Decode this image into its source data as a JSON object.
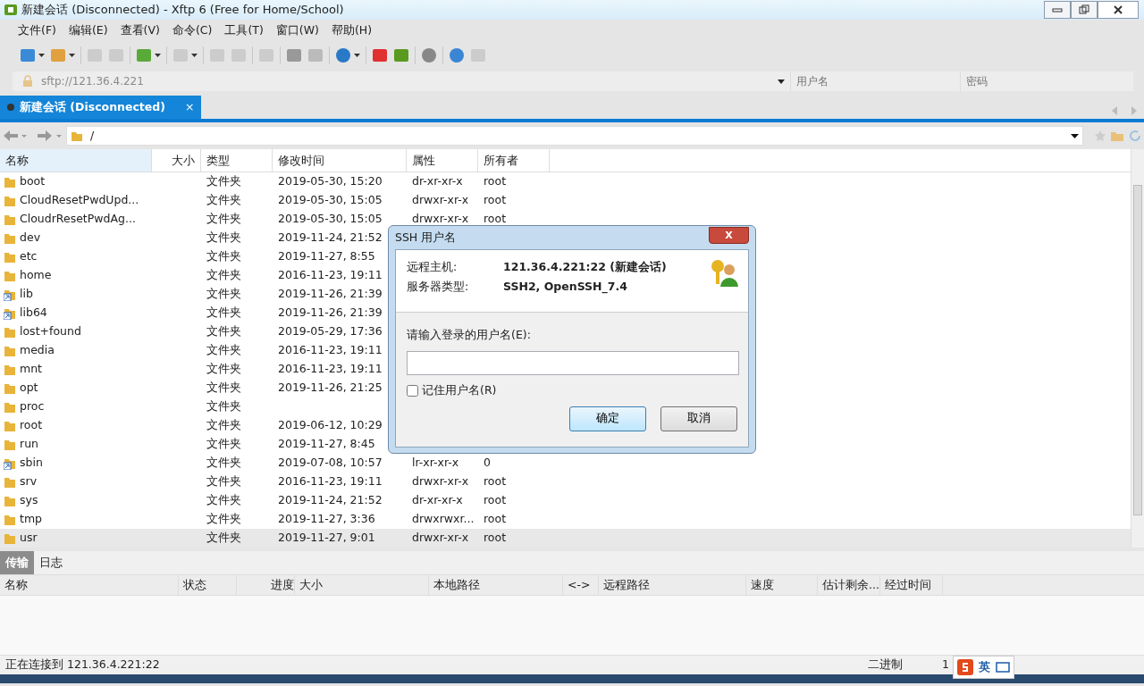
{
  "window": {
    "title": "新建会话 (Disconnected) - Xftp 6 (Free for Home/School)"
  },
  "menu": [
    "文件(F)",
    "编辑(E)",
    "查看(V)",
    "命令(C)",
    "工具(T)",
    "窗口(W)",
    "帮助(H)"
  ],
  "address_bar": {
    "value": "sftp://121.36.4.221",
    "username": {
      "placeholder": "用户名"
    },
    "password": {
      "placeholder": "密码"
    }
  },
  "session_tabs": [
    {
      "label": "新建会话 (Disconnected)",
      "selected": true,
      "close": "×"
    }
  ],
  "path": {
    "value": "/"
  },
  "file_table": {
    "columns": [
      "名称",
      "大小",
      "类型",
      "修改时间",
      "属性",
      "所有者"
    ],
    "rows": [
      {
        "name": "boot",
        "kind": "folder",
        "type": "文件夹",
        "modified": "2019-05-30, 15:20",
        "attributes": "dr-xr-xr-x",
        "owner": "root",
        "selected": false
      },
      {
        "name": "CloudResetPwdUpd...",
        "kind": "folder",
        "type": "文件夹",
        "modified": "2019-05-30, 15:05",
        "attributes": "drwxr-xr-x",
        "owner": "root",
        "selected": false
      },
      {
        "name": "CloudrResetPwdAg...",
        "kind": "folder",
        "type": "文件夹",
        "modified": "2019-05-30, 15:05",
        "attributes": "drwxr-xr-x",
        "owner": "root",
        "selected": false
      },
      {
        "name": "dev",
        "kind": "folder",
        "type": "文件夹",
        "modified": "2019-11-24, 21:52",
        "selected": false
      },
      {
        "name": "etc",
        "kind": "folder",
        "type": "文件夹",
        "modified": "2019-11-27, 8:55",
        "selected": false
      },
      {
        "name": "home",
        "kind": "folder",
        "type": "文件夹",
        "modified": "2016-11-23, 19:11",
        "selected": false
      },
      {
        "name": "lib",
        "kind": "link",
        "type": "文件夹",
        "modified": "2019-11-26, 21:39",
        "selected": false
      },
      {
        "name": "lib64",
        "kind": "link",
        "type": "文件夹",
        "modified": "2019-11-26, 21:39",
        "selected": false
      },
      {
        "name": "lost+found",
        "kind": "folder",
        "type": "文件夹",
        "modified": "2019-05-29, 17:36",
        "selected": false
      },
      {
        "name": "media",
        "kind": "folder",
        "type": "文件夹",
        "modified": "2016-11-23, 19:11",
        "selected": false
      },
      {
        "name": "mnt",
        "kind": "folder",
        "type": "文件夹",
        "modified": "2016-11-23, 19:11",
        "selected": false
      },
      {
        "name": "opt",
        "kind": "folder",
        "type": "文件夹",
        "modified": "2019-11-26, 21:25",
        "selected": false
      },
      {
        "name": "proc",
        "kind": "folder",
        "type": "文件夹",
        "selected": false
      },
      {
        "name": "root",
        "kind": "folder",
        "type": "文件夹",
        "modified": "2019-06-12, 10:29",
        "selected": false
      },
      {
        "name": "run",
        "kind": "folder",
        "type": "文件夹",
        "modified": "2019-11-27, 8:45",
        "selected": false
      },
      {
        "name": "sbin",
        "kind": "link",
        "type": "文件夹",
        "modified": "2019-07-08, 10:57",
        "attributes": "lr-xr-xr-x",
        "owner": "0",
        "selected": false
      },
      {
        "name": "srv",
        "kind": "folder",
        "type": "文件夹",
        "modified": "2016-11-23, 19:11",
        "attributes": "drwxr-xr-x",
        "owner": "root",
        "selected": false
      },
      {
        "name": "sys",
        "kind": "folder",
        "type": "文件夹",
        "modified": "2019-11-24, 21:52",
        "attributes": "dr-xr-xr-x",
        "owner": "root",
        "selected": false
      },
      {
        "name": "tmp",
        "kind": "folder",
        "type": "文件夹",
        "modified": "2019-11-27, 3:36",
        "attributes": "drwxrwxr...",
        "owner": "root",
        "selected": false
      },
      {
        "name": "usr",
        "kind": "folder",
        "type": "文件夹",
        "modified": "2019-11-27, 9:01",
        "attributes": "drwxr-xr-x",
        "owner": "root",
        "selected": true
      }
    ]
  },
  "bottom_tabs": [
    {
      "label": "传输",
      "selected": true
    },
    {
      "label": "日志",
      "selected": false
    }
  ],
  "transfer_table": {
    "columns": [
      "名称",
      "状态",
      "进度",
      "大小",
      "本地路径",
      "<->",
      "远程路径",
      "速度",
      "估计剩余...",
      "经过时间"
    ]
  },
  "status_bar": {
    "text": "正在连接到 121.36.4.221:22",
    "mode": "二进制",
    "count": "1"
  },
  "ime": {
    "label": "英"
  },
  "dialog": {
    "title": "SSH 用户名",
    "close": "X",
    "info": [
      {
        "label": "远程主机:",
        "value": "121.36.4.221:22 (新建会话)"
      },
      {
        "label": "服务器类型:",
        "value": "SSH2, OpenSSH_7.4"
      }
    ],
    "prompt": "请输入登录的用户名(E):",
    "remember": {
      "label": "记住用户名(R)",
      "checked": false
    },
    "buttons": [
      {
        "label": "确定",
        "default": true
      },
      {
        "label": "取消",
        "default": false
      }
    ]
  }
}
